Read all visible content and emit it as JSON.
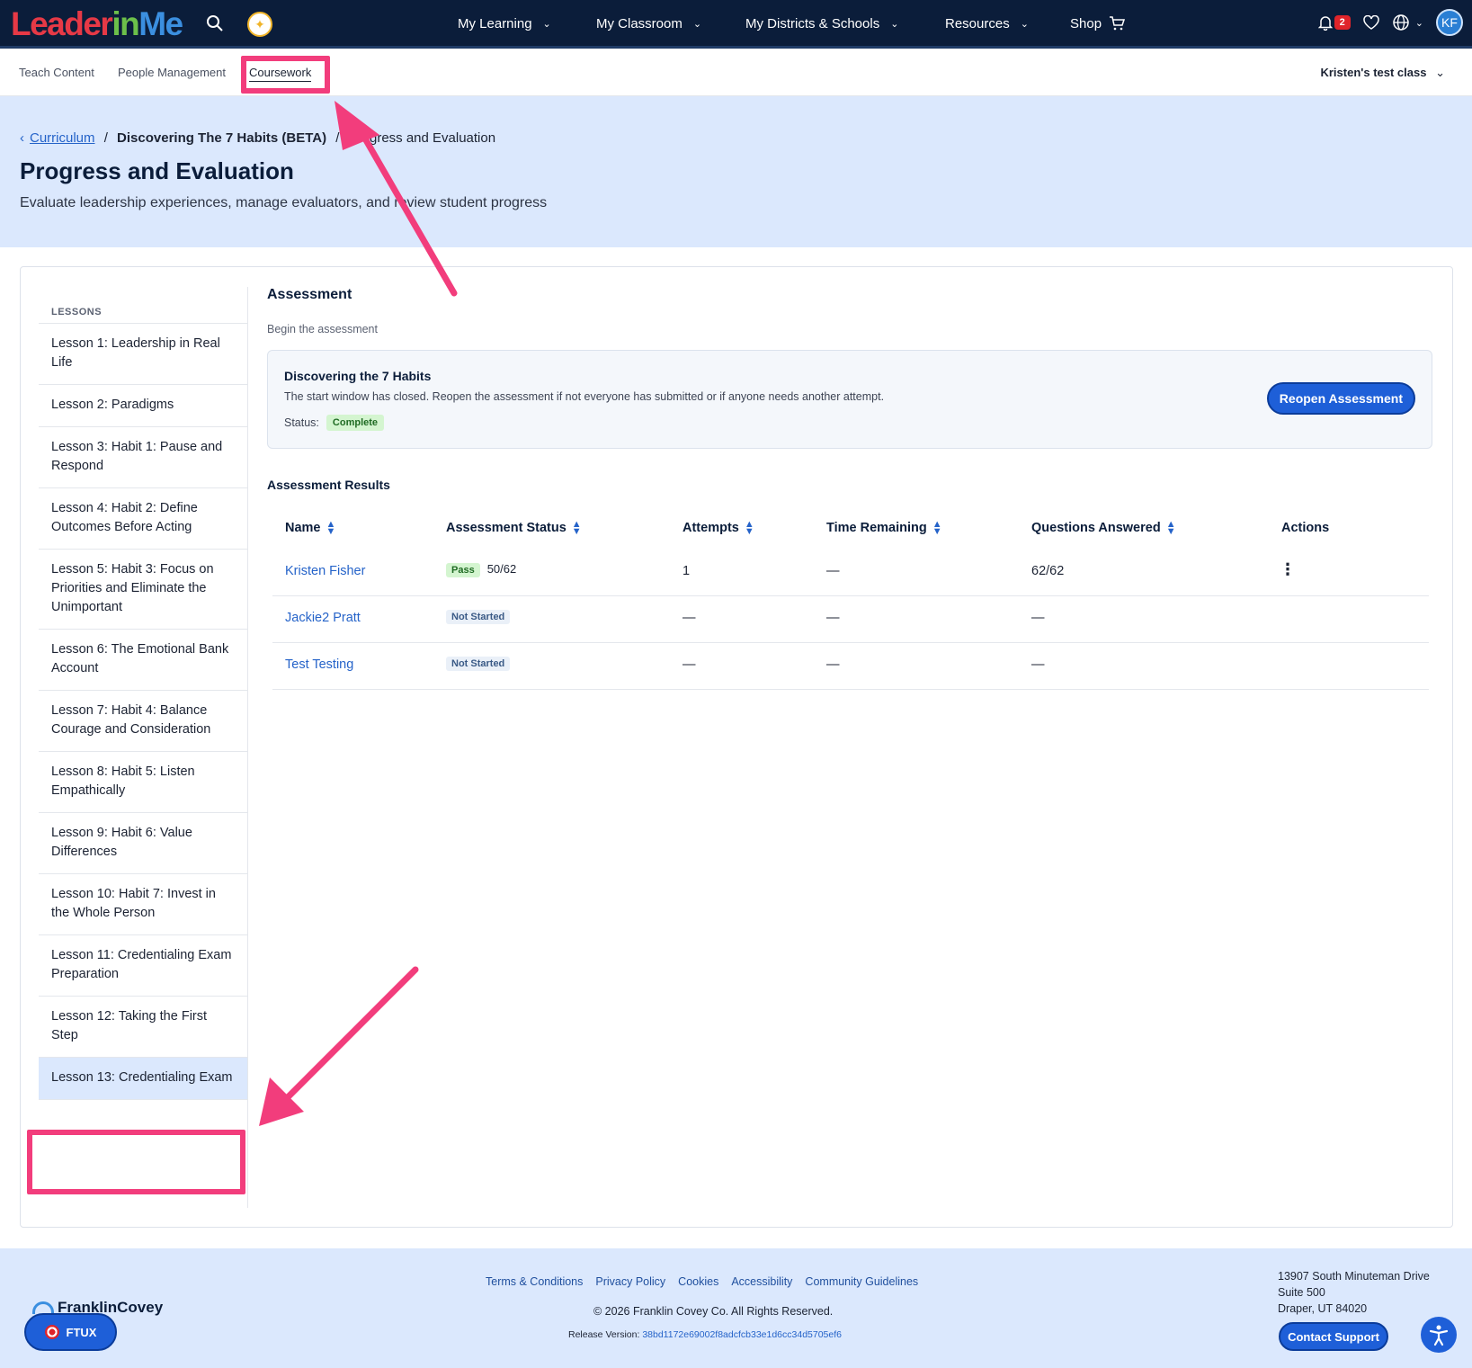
{
  "brand": {
    "logo_part1": "Leader",
    "logo_part2": "in",
    "logo_part3": "Me",
    "colors": {
      "navy": "#0b1d3a",
      "accent_blue": "#1e5fd8",
      "hero_bg": "#dbe8fd",
      "highlight_pink": "#f23d7c"
    }
  },
  "topnav": {
    "items": [
      {
        "label": "My Learning"
      },
      {
        "label": "My Classroom"
      },
      {
        "label": "My Districts & Schools"
      },
      {
        "label": "Resources"
      },
      {
        "label": "Shop"
      }
    ],
    "notifications_count": "2",
    "avatar_initials": "KF"
  },
  "subnav": {
    "tabs": [
      {
        "label": "Teach Content"
      },
      {
        "label": "People Management"
      },
      {
        "label": "Coursework"
      }
    ],
    "class_selector": "Kristen's test class"
  },
  "hero": {
    "breadcrumb": {
      "root": "Curriculum",
      "sep": "/",
      "course": "Discovering The 7 Habits (BETA)",
      "current": "Progress and Evaluation"
    },
    "title": "Progress and Evaluation",
    "subtitle": "Evaluate leadership experiences, manage evaluators, and review student progress"
  },
  "sidebar": {
    "heading": "LESSONS",
    "lessons": [
      "Lesson 1: Leadership in Real Life",
      "Lesson 2: Paradigms",
      "Lesson 3: Habit 1: Pause and Respond",
      "Lesson 4: Habit 2: Define Outcomes Before Acting",
      "Lesson 5: Habit 3: Focus on Priorities and Eliminate the Unimportant",
      "Lesson 6: The Emotional Bank Account",
      "Lesson 7: Habit 4: Balance Courage and Consideration",
      "Lesson 8: Habit 5: Listen Empathically",
      "Lesson 9: Habit 6: Value Differences",
      "Lesson 10: Habit 7: Invest in the Whole Person",
      "Lesson 11: Credentialing Exam Preparation",
      "Lesson 12: Taking the First Step",
      "Lesson 13: Credentialing Exam"
    ]
  },
  "assessment": {
    "heading": "Assessment",
    "subheading": "Begin the assessment",
    "box_title": "Discovering the 7 Habits",
    "box_desc": "The start window has closed. Reopen the assessment if not everyone has submitted or if anyone needs another attempt.",
    "status_label": "Status:",
    "status_value": "Complete",
    "reopen_label": "Reopen Assessment"
  },
  "results": {
    "title": "Assessment Results",
    "columns": [
      "Name",
      "Assessment Status",
      "Attempts",
      "Time Remaining",
      "Questions Answered",
      "Actions"
    ],
    "rows": [
      {
        "name": "Kristen Fisher",
        "status": "Pass",
        "score": "50/62",
        "attempts": "1",
        "time_remaining": "—",
        "questions": "62/62",
        "actions": "⋮"
      },
      {
        "name": "Jackie2 Pratt",
        "status": "Not Started",
        "score": "",
        "attempts": "—",
        "time_remaining": "—",
        "questions": "—",
        "actions": ""
      },
      {
        "name": "Test Testing",
        "status": "Not Started",
        "score": "",
        "attempts": "—",
        "time_remaining": "—",
        "questions": "—",
        "actions": ""
      }
    ]
  },
  "footer": {
    "brand": "FranklinCovey",
    "ftux_label": "FTUX",
    "links": [
      "Terms & Conditions",
      "Privacy Policy",
      "Cookies",
      "Accessibility",
      "Community Guidelines"
    ],
    "copyright": "© 2026 Franklin Covey Co. All Rights Reserved.",
    "release_label": "Release Version:",
    "release_hash": "38bd1172e69002f8adcfcb33e1d6cc34d5705ef6",
    "address_line1": "13907 South Minuteman Drive",
    "address_line2": "Suite 500",
    "address_line3": "Draper, UT 84020",
    "contact_label": "Contact Support"
  }
}
